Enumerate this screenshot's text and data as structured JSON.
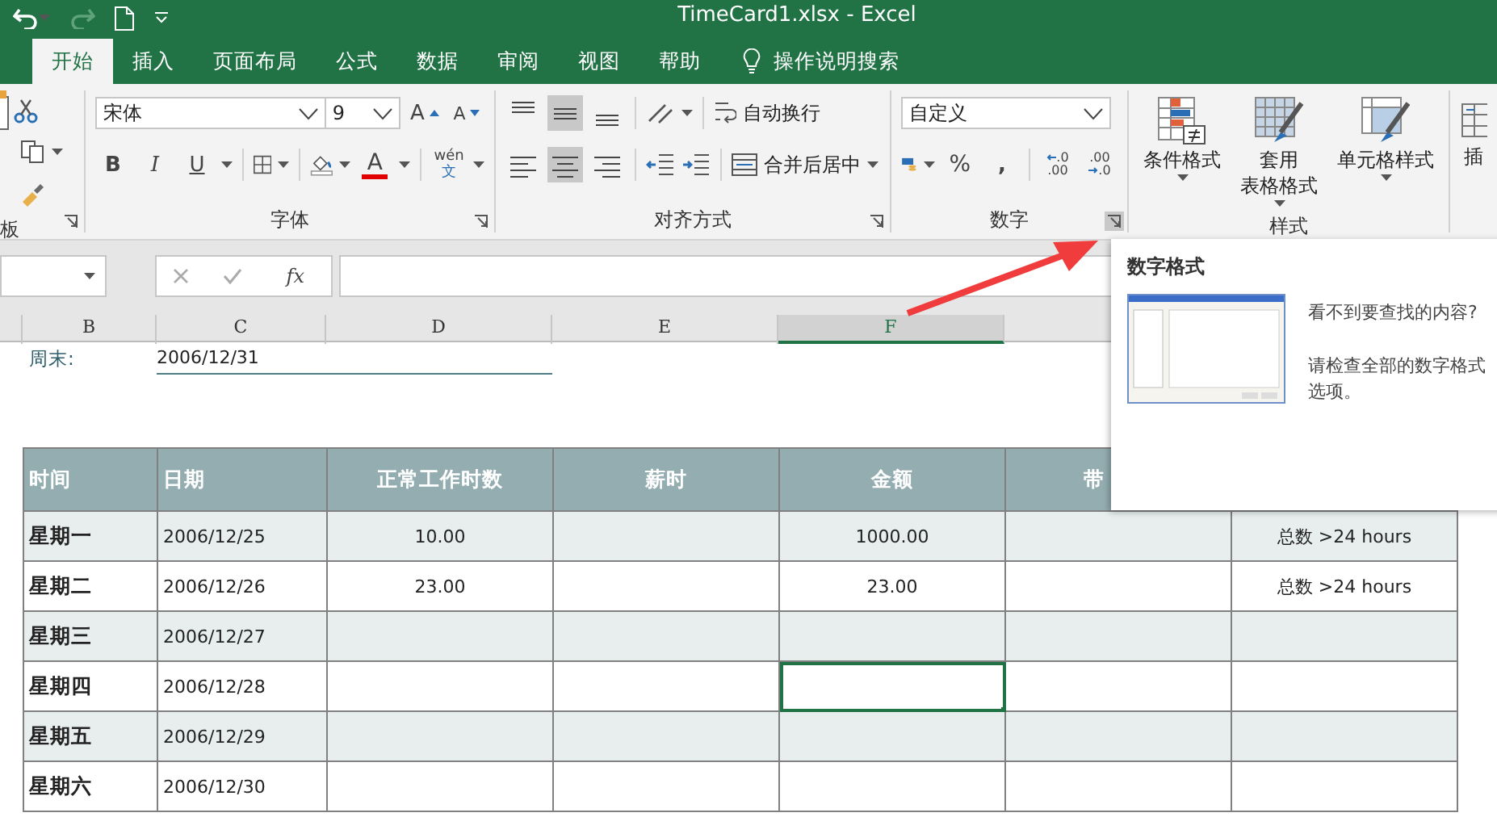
{
  "title_bar": {
    "title": "TimeCard1.xlsx  -  Excel"
  },
  "ribbon_tabs": [
    {
      "label": "开始",
      "selected": true
    },
    {
      "label": "插入",
      "selected": false
    },
    {
      "label": "页面布局",
      "selected": false
    },
    {
      "label": "公式",
      "selected": false
    },
    {
      "label": "数据",
      "selected": false
    },
    {
      "label": "审阅",
      "selected": false
    },
    {
      "label": "视图",
      "selected": false
    },
    {
      "label": "帮助",
      "selected": false
    }
  ],
  "tell_me": {
    "placeholder": "操作说明搜索"
  },
  "clipboard": {
    "label": "板"
  },
  "font": {
    "label": "字体",
    "font_name": "宋体",
    "font_size": "9",
    "grow": "A",
    "shrink": "A",
    "bold": "B",
    "italic": "I",
    "underline": "U",
    "font_color": "A",
    "phonetic_top": "wén",
    "phonetic_bottom": "文"
  },
  "alignment": {
    "label": "对齐方式",
    "vertical": [
      {
        "kind": "top",
        "selected": false
      },
      {
        "kind": "middle",
        "selected": true
      },
      {
        "kind": "bottom",
        "selected": false
      }
    ],
    "horizontal": [
      {
        "kind": "left",
        "selected": false
      },
      {
        "kind": "center",
        "selected": true
      },
      {
        "kind": "right",
        "selected": false
      }
    ],
    "wrap_text": "自动换行",
    "merge_center": "合并后居中"
  },
  "number": {
    "label": "数字",
    "format": "自定义",
    "percent": "%",
    "comma": ",",
    "increase_decimal": [
      ".0",
      ".00"
    ],
    "decrease_decimal": [
      ".00",
      ".0"
    ]
  },
  "styles": {
    "label": "样式",
    "buttons": [
      {
        "kind": "conditional",
        "lines": [
          "条件格式"
        ]
      },
      {
        "kind": "table",
        "lines": [
          "套用",
          "表格格式"
        ]
      },
      {
        "kind": "cell",
        "lines": [
          "单元格样式"
        ]
      }
    ]
  },
  "cells": {
    "label": "插"
  },
  "formula_bar": {
    "fx": "fx"
  },
  "column_headers": [
    {
      "label": "B",
      "selected": false
    },
    {
      "label": "C",
      "selected": false
    },
    {
      "label": "D",
      "selected": false
    },
    {
      "label": "E",
      "selected": false
    },
    {
      "label": "F",
      "selected": true
    }
  ],
  "week_end": {
    "label": "周末:",
    "value": "2006/12/31"
  },
  "table": {
    "columns": [
      "时间",
      "日期",
      "正常工作时数",
      "薪时",
      "金额",
      "带"
    ],
    "rows": [
      {
        "day": "星期一",
        "date": "2006/12/25",
        "hours": "10.00",
        "amount": "1000.00",
        "note": "总数 >24 hours",
        "amount_selected": false
      },
      {
        "day": "星期二",
        "date": "2006/12/26",
        "hours": "23.00",
        "amount": "23.00",
        "note": "总数 >24 hours",
        "amount_selected": false
      },
      {
        "day": "星期三",
        "date": "2006/12/27",
        "amount_selected": false
      },
      {
        "day": "星期四",
        "date": "2006/12/28",
        "amount_selected": true
      },
      {
        "day": "星期五",
        "date": "2006/12/29",
        "amount_selected": false
      },
      {
        "day": "星期六",
        "date": "2006/12/30",
        "amount_selected": false
      }
    ]
  },
  "tooltip": {
    "title": "数字格式",
    "question": "看不到要查找的内容?",
    "hint": "请检查全部的数字格式选项。"
  }
}
